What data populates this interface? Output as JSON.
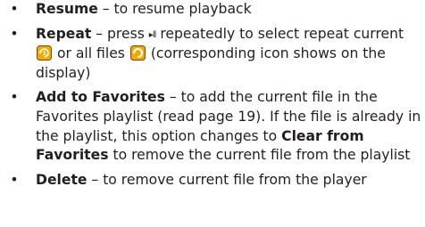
{
  "items": [
    {
      "bullet": "•",
      "title": "Resume",
      "text": " – to resume playback"
    },
    {
      "bullet": "•",
      "title": "Repeat",
      "text_before_icon": " – press ",
      "playpause_symbol": "▸ll",
      "text_mid": " repeatedly to select repeat current ",
      "repeat_one_icon": "repeat-one-icon",
      "text_between_icons": " or all files ",
      "repeat_all_icon": "repeat-all-icon",
      "text_end": " (corresponding icon shows on the display)"
    },
    {
      "bullet": "•",
      "title": "Add to Favorites",
      "text": " – to add the current file in the Favorites playlist (read page 19). If the file is already in the playlist, this option changes to ",
      "title2": "Clear from Favorites",
      "text2": " to remove the current file from the playlist"
    },
    {
      "bullet": "•",
      "title": "Delete",
      "text": " – to remove current file from the player"
    }
  ],
  "icon_colors": {
    "repeat_one_fill": "#f2a900",
    "repeat_all_fill": "#f2a900",
    "icon_stroke": "#7a4a00"
  }
}
